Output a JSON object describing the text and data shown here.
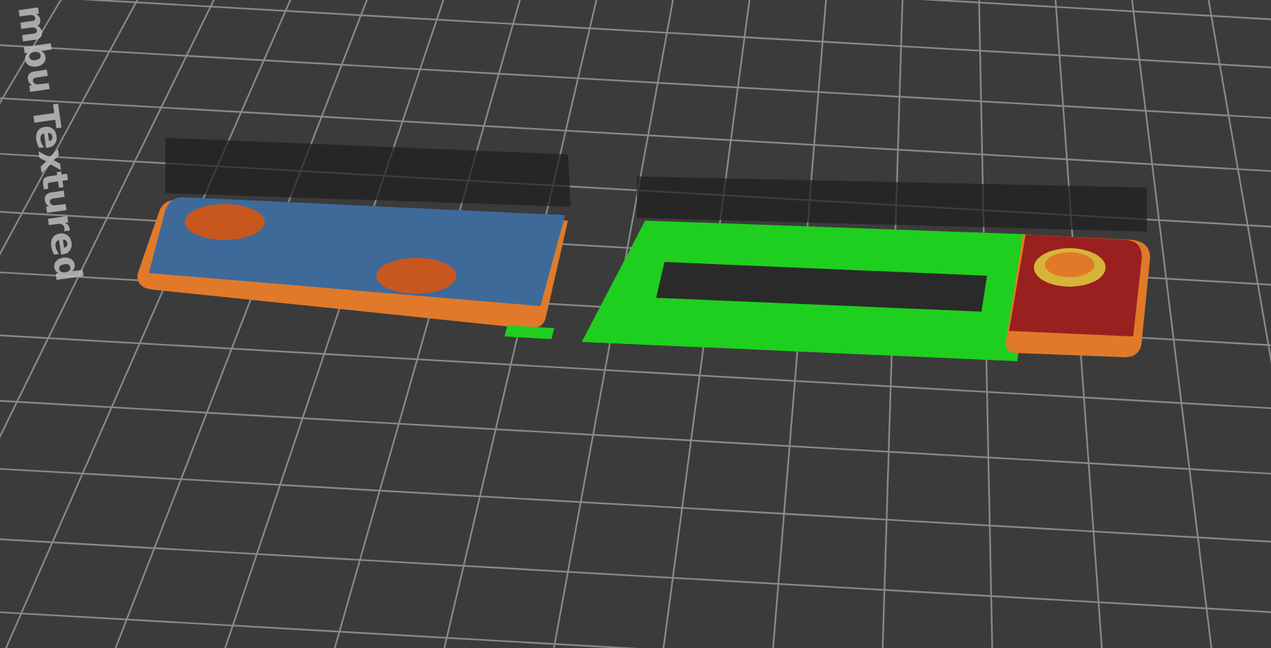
{
  "viewport": {
    "bed_label": "mbu Textured"
  }
}
